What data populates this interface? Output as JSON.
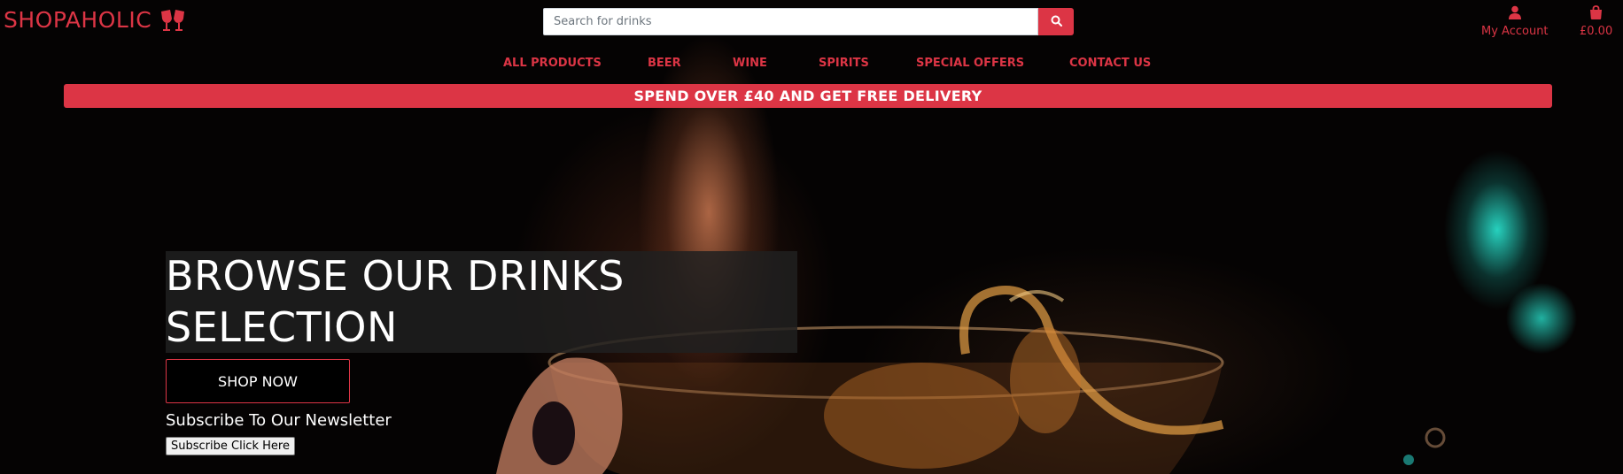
{
  "brand": {
    "name": "SHOPAHOLIC",
    "icon": "clinking-glasses-icon"
  },
  "search": {
    "placeholder": "Search for drinks",
    "value": "",
    "button_icon": "search-icon"
  },
  "header_links": {
    "account": {
      "label": "My Account",
      "icon": "user-icon"
    },
    "bag": {
      "label": "£0.00",
      "icon": "shopping-bag-icon"
    }
  },
  "nav": {
    "items": [
      {
        "label": "ALL PRODUCTS"
      },
      {
        "label": "BEER"
      },
      {
        "label": "WINE"
      },
      {
        "label": "SPIRITS"
      },
      {
        "label": "SPECIAL OFFERS"
      },
      {
        "label": "CONTACT US"
      }
    ]
  },
  "banner": {
    "text": "SPEND OVER £40 AND GET FREE DELIVERY"
  },
  "hero": {
    "headline_line1": "BROWSE OUR DRINKS",
    "headline_line2": "SELECTION",
    "cta": "SHOP NOW",
    "newsletter_label": "Subscribe To Our Newsletter",
    "subscribe_button": "Subscribe Click Here"
  },
  "colors": {
    "accent": "#dc3545",
    "background": "#000000",
    "text": "#ffffff"
  }
}
